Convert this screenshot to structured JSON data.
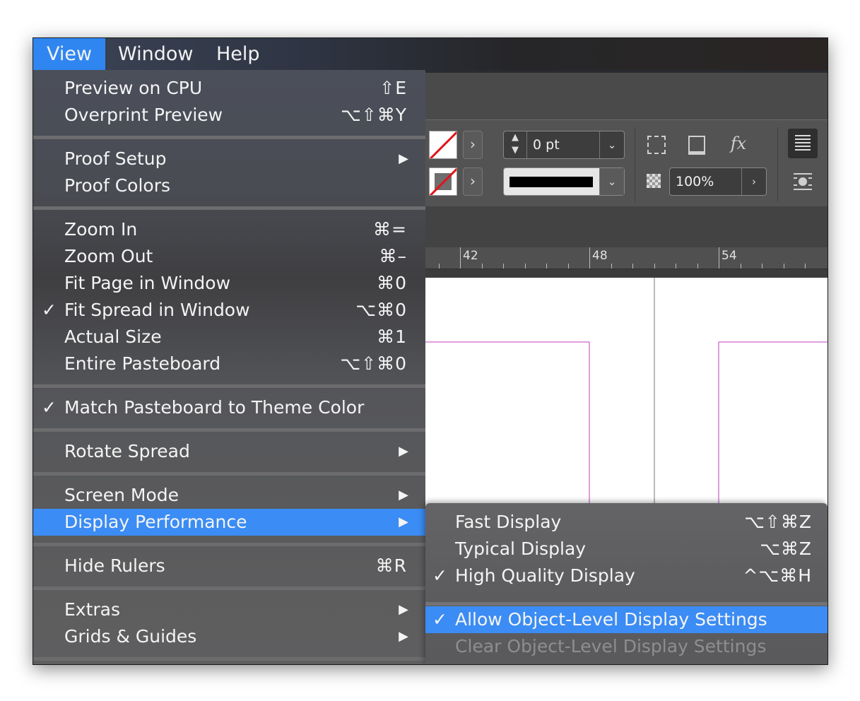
{
  "menubar": {
    "items": [
      "View",
      "Window",
      "Help"
    ],
    "active": "View"
  },
  "colors": {
    "highlight": "#3b8cf4",
    "menubar_active": "#2f86f0",
    "guide": "#c23fc2",
    "stroke_none": "#e0141c"
  },
  "view_menu": {
    "groups": [
      [
        {
          "label": "Preview on CPU",
          "shortcut": "⇧E"
        },
        {
          "label": "Overprint Preview",
          "shortcut": "⌥⇧⌘Y"
        }
      ],
      [
        {
          "label": "Proof Setup",
          "submenu": true
        },
        {
          "label": "Proof Colors"
        }
      ],
      [
        {
          "label": "Zoom In",
          "shortcut": "⌘="
        },
        {
          "label": "Zoom Out",
          "shortcut": "⌘–"
        },
        {
          "label": "Fit Page in Window",
          "shortcut": "⌘0"
        },
        {
          "label": "Fit Spread in Window",
          "shortcut": "⌥⌘0",
          "checked": true
        },
        {
          "label": "Actual Size",
          "shortcut": "⌘1"
        },
        {
          "label": "Entire Pasteboard",
          "shortcut": "⌥⇧⌘0"
        }
      ],
      [
        {
          "label": "Match Pasteboard to Theme Color",
          "checked": true
        }
      ],
      [
        {
          "label": "Rotate Spread",
          "submenu": true
        }
      ],
      [
        {
          "label": "Screen Mode",
          "submenu": true
        },
        {
          "label": "Display Performance",
          "submenu": true,
          "highlighted": true
        }
      ],
      [
        {
          "label": "Hide Rulers",
          "shortcut": "⌘R"
        }
      ],
      [
        {
          "label": "Extras",
          "submenu": true
        },
        {
          "label": "Grids & Guides",
          "submenu": true
        }
      ]
    ]
  },
  "display_performance_submenu": {
    "items": [
      {
        "label": "Fast Display",
        "shortcut": "⌥⇧⌘Z"
      },
      {
        "label": "Typical Display",
        "shortcut": "⌥⌘Z"
      },
      {
        "label": "High Quality Display",
        "shortcut": "^⌥⌘H",
        "checked": true
      },
      {
        "label": "Allow Object-Level Display Settings",
        "checked": true,
        "highlighted": true
      },
      {
        "label": "Clear Object-Level Display Settings",
        "disabled": true
      }
    ]
  },
  "control_panel": {
    "stroke_weight": "0 pt",
    "opacity": "100%",
    "fx_label": "fx"
  },
  "ruler": {
    "labels": [
      "42",
      "48",
      "54"
    ]
  },
  "glyphs": {
    "check": "✓",
    "submenu_arrow": "▶",
    "chevron_right": "›",
    "chevron_down": "⌄"
  }
}
